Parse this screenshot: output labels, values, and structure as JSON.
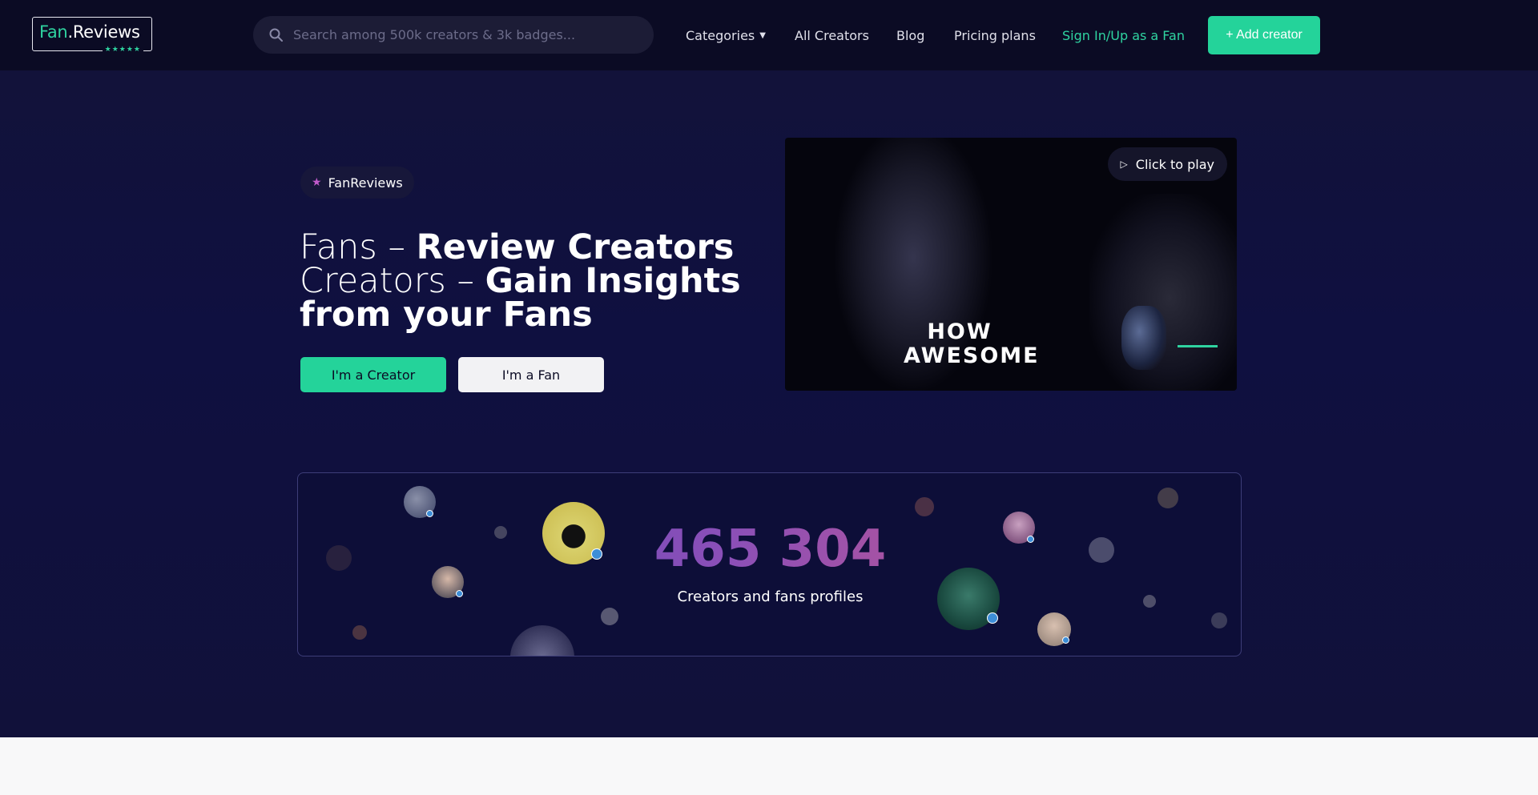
{
  "header": {
    "logo_fan": "Fan",
    "logo_rest": ".Reviews",
    "logo_stars": "★★★★★",
    "search_placeholder": "Search among 500k creators & 3k badges...",
    "nav": {
      "categories": "Categories",
      "all_creators": "All Creators",
      "blog": "Blog",
      "pricing": "Pricing plans",
      "sign_in": "Sign In/Up as a Fan"
    },
    "add_creator": "+ Add creator"
  },
  "hero": {
    "chip_label": "FanReviews",
    "line1_light": "Fans – ",
    "line1_bold": "Review Creators",
    "line2_light": "Creators – ",
    "line2_bold": "Gain Insights",
    "line3_bold": "from your Fans",
    "btn_creator": "I'm a Creator",
    "btn_fan": "I'm a Fan"
  },
  "video": {
    "caption_line1": "HOW",
    "caption_line2": "AWESOME",
    "play_label": "Click to play"
  },
  "stats": {
    "count": "465 304",
    "label": "Creators and fans profiles"
  },
  "colors": {
    "accent": "#24d39a",
    "background": "#0f0f2e",
    "badge": "#3d8ed8"
  }
}
